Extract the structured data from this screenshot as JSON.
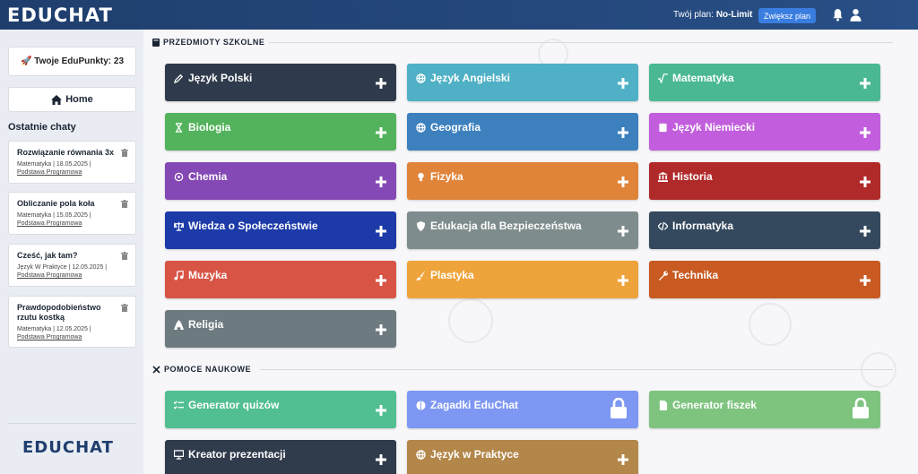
{
  "header": {
    "logo": "EDUCHAT",
    "plan_label": "Twój plan:",
    "plan_value": "No-Limit",
    "upgrade_label": "Zwiększ plan"
  },
  "sidebar": {
    "edupoints": "🚀 Twoje EduPunkty: 23",
    "home_label": "Home",
    "recent_title": "Ostatnie chaty",
    "chats": [
      {
        "title": "Rozwiązanie równania 3x",
        "meta": "Matematyka | 18.05.2025 |",
        "link": "Podstawa Programowa"
      },
      {
        "title": "Obliczanie pola koła",
        "meta": "Matematyka | 15.05.2025 |",
        "link": "Podstawa Programowa"
      },
      {
        "title": "Cześć, jak tam?",
        "meta": "Język W Praktyce | 12.05.2025 |",
        "link": "Podstawa Programowa"
      },
      {
        "title": "Prawdopodobieństwo rzutu kostką",
        "meta": "Matematyka | 12.05.2025 |",
        "link": "Podstawa Programowa"
      }
    ],
    "footer_logo": "EDUCHAT"
  },
  "subjects": {
    "title": "PRZEDMIOTY SZKOLNE",
    "items": [
      {
        "label": "Język Polski",
        "icon": "pencil-icon",
        "color": "#2f3b4c"
      },
      {
        "label": "Język Angielski",
        "icon": "globe-icon",
        "color": "#4fb0c6"
      },
      {
        "label": "Matematyka",
        "icon": "sqrt-icon",
        "color": "#49b893"
      },
      {
        "label": "Biologia",
        "icon": "hourglass-icon",
        "color": "#53b35c"
      },
      {
        "label": "Geografia",
        "icon": "globe-icon",
        "color": "#3c80be"
      },
      {
        "label": "Język Niemiecki",
        "icon": "book-icon",
        "color": "#c25edd"
      },
      {
        "label": "Chemia",
        "icon": "atom-icon",
        "color": "#8549b5"
      },
      {
        "label": "Fizyka",
        "icon": "lightbulb-icon",
        "color": "#e0843a"
      },
      {
        "label": "Historia",
        "icon": "landmark-icon",
        "color": "#b02a2a"
      },
      {
        "label": "Wiedza o Społeczeństwie",
        "icon": "scales-icon",
        "color": "#1c3aa8"
      },
      {
        "label": "Edukacja dla Bezpieczeństwa",
        "icon": "shield-icon",
        "color": "#7f8c8d"
      },
      {
        "label": "Informatyka",
        "icon": "code-icon",
        "color": "#34495e"
      },
      {
        "label": "Muzyka",
        "icon": "music-icon",
        "color": "#d85445"
      },
      {
        "label": "Plastyka",
        "icon": "brush-icon",
        "color": "#eea33b"
      },
      {
        "label": "Technika",
        "icon": "wrench-icon",
        "color": "#c85a22"
      },
      {
        "label": "Religia",
        "icon": "church-icon",
        "color": "#6d7a80"
      }
    ]
  },
  "tools": {
    "title": "POMOCE NAUKOWE",
    "items": [
      {
        "label": "Generator quizów",
        "icon": "list-check-icon",
        "color": "#52bf92",
        "locked": false
      },
      {
        "label": "Zagadki EduChat",
        "icon": "brain-icon",
        "color": "#7d97f2",
        "locked": true
      },
      {
        "label": "Generator fiszek",
        "icon": "file-icon",
        "color": "#7ec47f",
        "locked": true
      },
      {
        "label": "Kreator prezentacji",
        "icon": "presentation-icon",
        "color": "#303b4c",
        "locked": false
      },
      {
        "label": "Język w Praktyce",
        "icon": "globe-icon",
        "color": "#b3874a",
        "locked": false
      }
    ]
  }
}
